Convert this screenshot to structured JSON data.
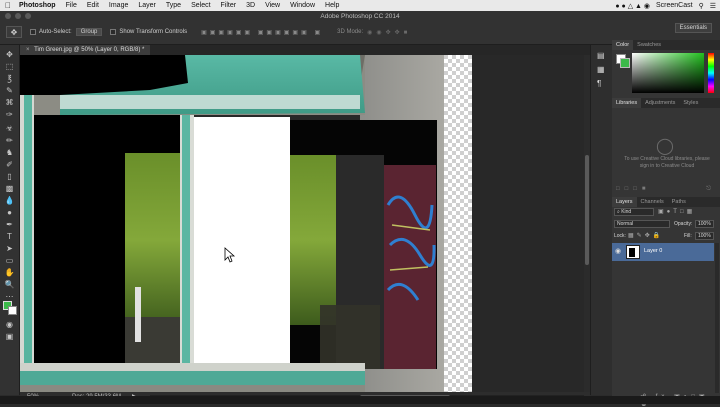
{
  "mac_menu": {
    "app_name": "Photoshop",
    "items": [
      "File",
      "Edit",
      "Image",
      "Layer",
      "Type",
      "Select",
      "Filter",
      "3D",
      "View",
      "Window",
      "Help"
    ],
    "right_label": "ScreenCast"
  },
  "window_title": "Adobe Photoshop CC 2014",
  "options": {
    "auto_select_label": "Auto-Select:",
    "auto_select_value": "Group",
    "show_transform_label": "Show Transform Controls",
    "mode_3d_label": "3D Mode:"
  },
  "workspace": "Essentials",
  "document_tab": "Tim Green.jpg @ 50% (Layer 0, RGB/8) *",
  "status": {
    "zoom": "50%",
    "doc_size": "Doc: 29.5M/33.6M"
  },
  "panels": {
    "color_tabs": [
      "Color",
      "Swatches"
    ],
    "library_tabs": [
      "Libraries",
      "Adjustments",
      "Styles"
    ],
    "library_message": "To use Creative Cloud libraries, please sign in to Creative Cloud",
    "layers_tabs": [
      "Layers",
      "Channels",
      "Paths"
    ],
    "kind_label": "Kind",
    "blend_mode": "Normal",
    "opacity_label": "Opacity:",
    "opacity_value": "100%",
    "lock_label": "Lock:",
    "fill_label": "Fill:",
    "fill_value": "100%",
    "layer_name": "Layer 0"
  },
  "colors": {
    "accent_selection": "#4a6a98",
    "foreground_swatch": "#3cb94a",
    "picker_hue": "#21c11e"
  }
}
